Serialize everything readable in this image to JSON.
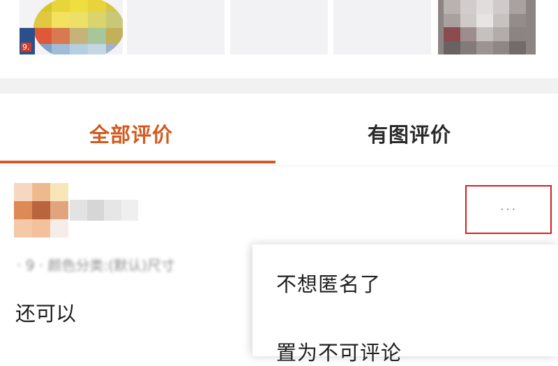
{
  "thumbnails": {
    "first_badge": "9.",
    "items": [
      "photo-1",
      "photo-2",
      "photo-3",
      "photo-4",
      "photo-5"
    ]
  },
  "tabs": [
    {
      "label": "全部评价",
      "active": true
    },
    {
      "label": "有图评价",
      "active": false
    }
  ],
  "review": {
    "meta_text": "· 9 · 颜色分类:(默认)尺寸",
    "text": "还可以",
    "more_label": "···"
  },
  "menu": {
    "items": [
      "不想匿名了",
      "置为不可评论"
    ]
  },
  "colors": {
    "accent": "#d25a1e",
    "highlight_border": "#d41f1f"
  }
}
